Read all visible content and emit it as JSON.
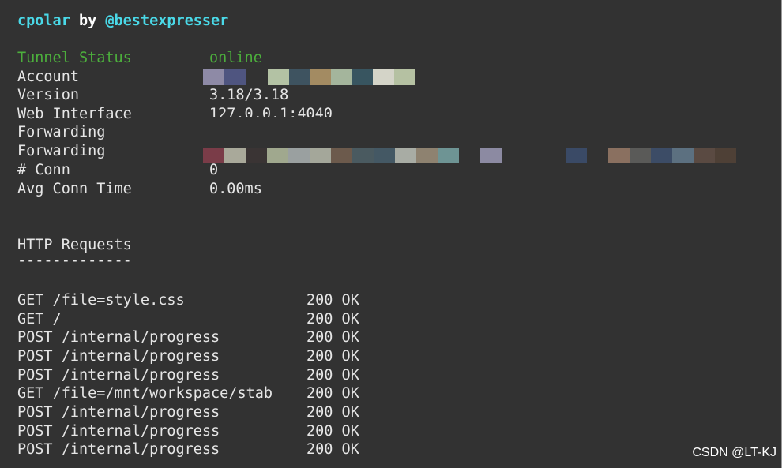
{
  "header": {
    "brand": "cpolar",
    "by": "by",
    "handle": "@bestexpresser"
  },
  "status": {
    "tunnel_label": "Tunnel Status",
    "tunnel_value": "online",
    "account_label": "Account",
    "version_label": "Version",
    "version_value": "3.18/3.18",
    "web_label": "Web Interface",
    "web_value": "127.0.0.1:4040",
    "forwarding1_label": "Forwarding",
    "forwarding2_label": "Forwarding",
    "conn_label": "# Conn",
    "conn_value": "0",
    "avg_label": "Avg Conn Time",
    "avg_value": "0.00ms"
  },
  "http": {
    "title": "HTTP Requests",
    "underline": "-------------",
    "requests": [
      {
        "request": "GET /file=style.css",
        "status": "200 OK"
      },
      {
        "request": "GET /",
        "status": "200 OK"
      },
      {
        "request": "POST /internal/progress",
        "status": "200 OK"
      },
      {
        "request": "POST /internal/progress",
        "status": "200 OK"
      },
      {
        "request": "POST /internal/progress",
        "status": "200 OK"
      },
      {
        "request": "GET /file=/mnt/workspace/stab",
        "status": "200 OK"
      },
      {
        "request": "POST /internal/progress",
        "status": "200 OK"
      },
      {
        "request": "POST /internal/progress",
        "status": "200 OK"
      },
      {
        "request": "POST /internal/progress",
        "status": "200 OK"
      }
    ]
  },
  "watermark": "CSDN @LT-KJ",
  "colors": {
    "background": "#323232",
    "header": "#4ad9e8",
    "status_green": "#4caf3c",
    "text": "#e6e6e6"
  }
}
